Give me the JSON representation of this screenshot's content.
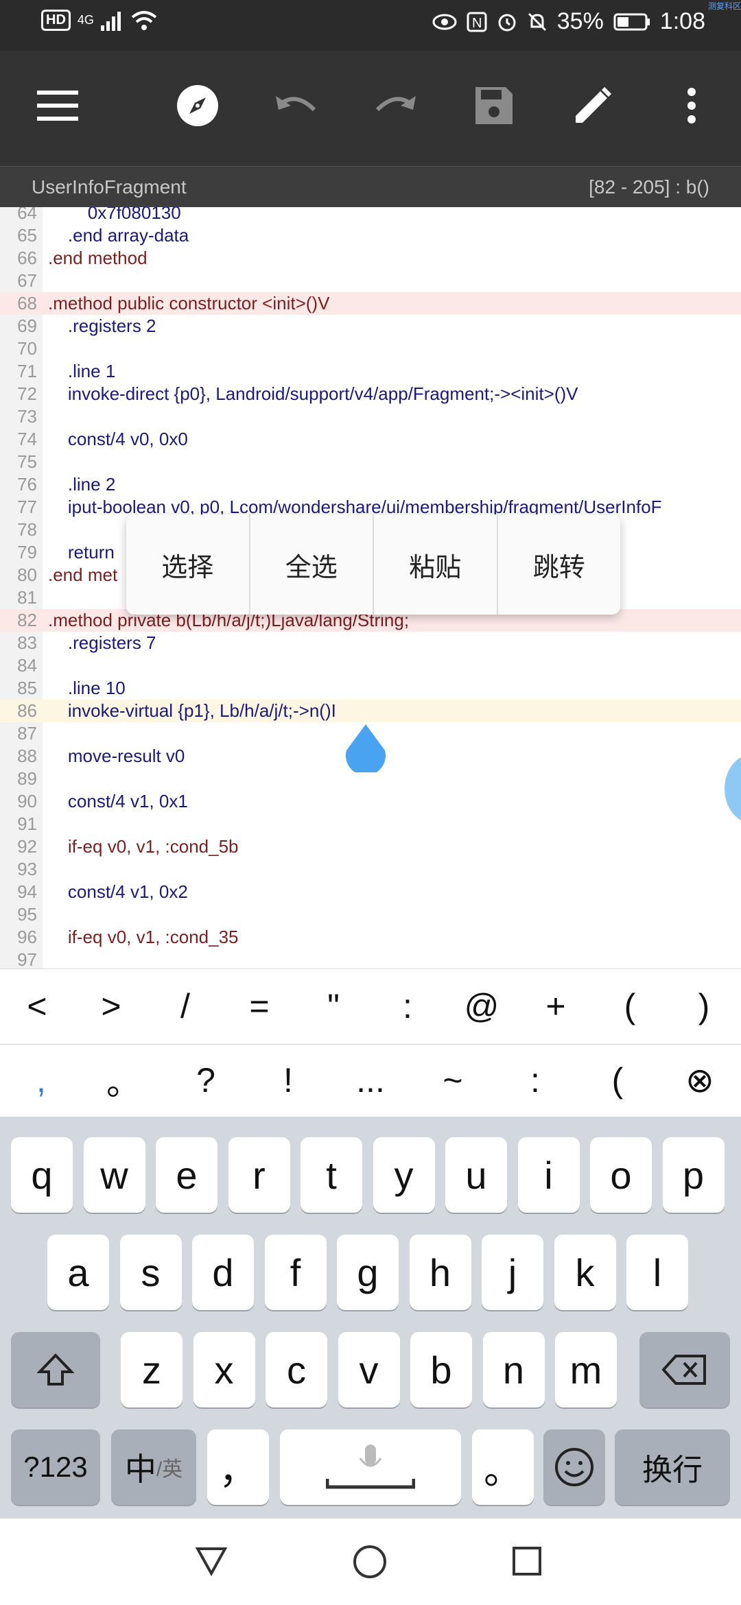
{
  "status_bar": {
    "network": "4G",
    "battery": "35%",
    "time": "1:08",
    "corner_text": "测复科区"
  },
  "toolbar": {
    "icons": [
      "menu-icon",
      "compass-icon",
      "undo-icon",
      "redo-icon",
      "save-icon",
      "edit-icon",
      "more-icon"
    ]
  },
  "title_bar": {
    "file": "UserInfoFragment",
    "position": "[82 - 205] : b()"
  },
  "code_lines": [
    {
      "n": "64",
      "text": "        0x7f080130"
    },
    {
      "n": "65",
      "text": "    .end array-data"
    },
    {
      "n": "66",
      "text": ".end method"
    },
    {
      "n": "67",
      "text": ""
    },
    {
      "n": "68",
      "text": ".method public constructor <init>()V"
    },
    {
      "n": "69",
      "text": "    .registers 2"
    },
    {
      "n": "70",
      "text": ""
    },
    {
      "n": "71",
      "text": "    .line 1"
    },
    {
      "n": "72",
      "text": "    invoke-direct {p0}, Landroid/support/v4/app/Fragment;-><init>()V"
    },
    {
      "n": "73",
      "text": ""
    },
    {
      "n": "74",
      "text": "    const/4 v0, 0x0"
    },
    {
      "n": "75",
      "text": ""
    },
    {
      "n": "76",
      "text": "    .line 2"
    },
    {
      "n": "77",
      "text": "    iput-boolean v0, p0, Lcom/wondershare/ui/membership/fragment/UserInfoF"
    },
    {
      "n": "78",
      "text": ""
    },
    {
      "n": "79",
      "text": "    return"
    },
    {
      "n": "80",
      "text": ".end met"
    },
    {
      "n": "81",
      "text": ""
    },
    {
      "n": "82",
      "text": ".method private b(Lb/h/a/j/t;)Ljava/lang/String;"
    },
    {
      "n": "83",
      "text": "    .registers 7"
    },
    {
      "n": "84",
      "text": ""
    },
    {
      "n": "85",
      "text": "    .line 10"
    },
    {
      "n": "86",
      "text": "    invoke-virtual {p1}, Lb/h/a/j/t;->n()I"
    },
    {
      "n": "87",
      "text": ""
    },
    {
      "n": "88",
      "text": "    move-result v0"
    },
    {
      "n": "89",
      "text": ""
    },
    {
      "n": "90",
      "text": "    const/4 v1, 0x1"
    },
    {
      "n": "91",
      "text": ""
    },
    {
      "n": "92",
      "text": "    if-eq v0, v1, :cond_5b"
    },
    {
      "n": "93",
      "text": ""
    },
    {
      "n": "94",
      "text": "    const/4 v1, 0x2"
    },
    {
      "n": "95",
      "text": ""
    },
    {
      "n": "96",
      "text": "    if-eq v0, v1, :cond_35"
    },
    {
      "n": "97",
      "text": ""
    }
  ],
  "context_menu": [
    "选择",
    "全选",
    "粘贴",
    "跳转"
  ],
  "symbols_row1": [
    "<",
    ">",
    "/",
    "=",
    "\"",
    ":",
    "@",
    "+",
    "(",
    ")"
  ],
  "symbols_row2": [
    ",",
    "。",
    "?",
    "!",
    "...",
    "~",
    ":",
    "(",
    "⊗"
  ],
  "keyboard": {
    "row1": [
      "q",
      "w",
      "e",
      "r",
      "t",
      "y",
      "u",
      "i",
      "o",
      "p"
    ],
    "row2": [
      "a",
      "s",
      "d",
      "f",
      "g",
      "h",
      "j",
      "k",
      "l"
    ],
    "row3": [
      "z",
      "x",
      "c",
      "v",
      "b",
      "n",
      "m"
    ],
    "num_key": "?123",
    "lang_key": "中",
    "lang_sub": "/英",
    "comma_key": "，",
    "period_key": "。",
    "enter_key": "换行"
  }
}
